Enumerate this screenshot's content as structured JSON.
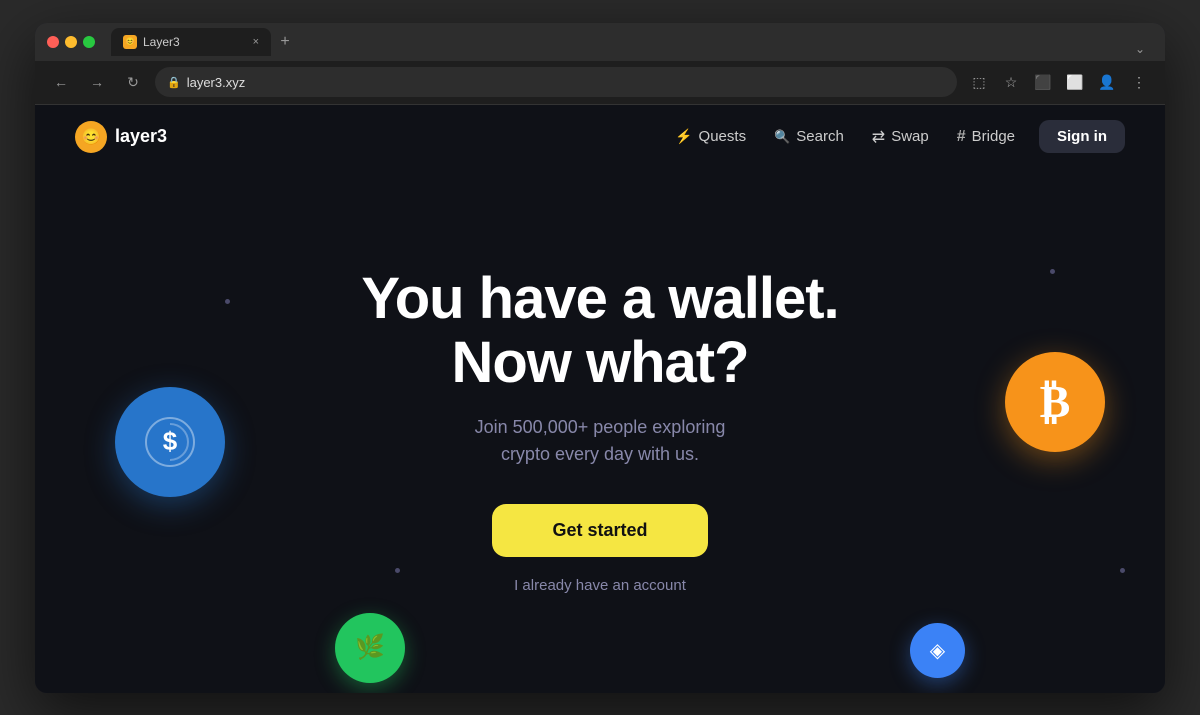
{
  "browser": {
    "tab_favicon": "😊",
    "tab_title": "Layer3",
    "tab_close": "×",
    "tab_new": "+",
    "tab_chevron": "⌄",
    "nav_back": "←",
    "nav_forward": "→",
    "nav_reload": "↻",
    "address_url": "layer3.xyz",
    "nav_screenshot": "⬚",
    "nav_star": "☆",
    "nav_extensions": "⬛",
    "nav_split": "⬜",
    "nav_profile": "👤",
    "nav_menu": "⋮"
  },
  "site": {
    "logo_icon": "😊",
    "logo_text": "layer3",
    "nav_quests_icon": "⚡",
    "nav_quests_label": "Quests",
    "nav_search_icon": "🔍",
    "nav_search_label": "Search",
    "nav_swap_icon": "⇄",
    "nav_swap_label": "Swap",
    "nav_bridge_icon": "#",
    "nav_bridge_label": "Bridge",
    "signin_label": "Sign in"
  },
  "hero": {
    "heading_line1": "You have a wallet.",
    "heading_line2": "Now what?",
    "subtitle": "Join 500,000+ people exploring\ncrypto every day with us.",
    "cta_label": "Get started",
    "login_label": "I already have an account"
  },
  "coins": {
    "usdc_symbol": "💲",
    "btc_symbol": "₿",
    "green_symbol": "✦",
    "blue_symbol": "◈"
  }
}
